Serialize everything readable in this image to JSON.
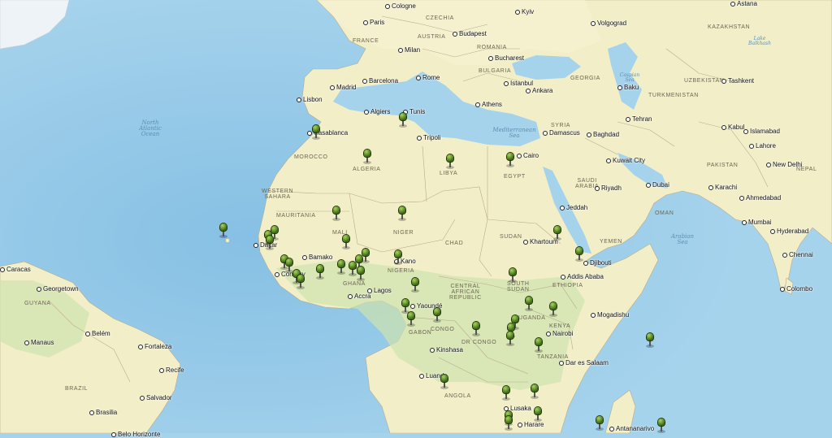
{
  "colors": {
    "ocean": "#a6d3ec",
    "ocean_deep": "#8dc4e6",
    "land": "#f2efc8",
    "land_green": "#c9e0a8",
    "border": "#b9aa8c",
    "pin": "#4f8a1b"
  },
  "oceans": [
    {
      "id": "north-atlantic",
      "text": "North\nAtlantic\nOcean"
    },
    {
      "id": "mediterranean",
      "text": "Mediterranean\nSea"
    },
    {
      "id": "arabian",
      "text": "Arabian\nSea"
    },
    {
      "id": "caspian",
      "text": "Caspian\nSea"
    },
    {
      "id": "lake-balkhash",
      "text": "Lake\nBalkhash"
    }
  ],
  "countries": [
    {
      "id": "france",
      "text": "FRANCE"
    },
    {
      "id": "czechia",
      "text": "CZECHIA"
    },
    {
      "id": "austria",
      "text": "AUSTRIA"
    },
    {
      "id": "romania",
      "text": "ROMANIA"
    },
    {
      "id": "bulgaria",
      "text": "BULGARIA"
    },
    {
      "id": "kazakhstan",
      "text": "KAZAKHSTAN"
    },
    {
      "id": "georgia",
      "text": "GEORGIA"
    },
    {
      "id": "uzbekistan",
      "text": "UZBEKISTAN"
    },
    {
      "id": "turkmenistan",
      "text": "TURKMENISTAN"
    },
    {
      "id": "syria",
      "text": "SYRIA"
    },
    {
      "id": "morocco",
      "text": "MOROCCO"
    },
    {
      "id": "algeria",
      "text": "ALGERIA"
    },
    {
      "id": "libya",
      "text": "LIBYA"
    },
    {
      "id": "egypt",
      "text": "EGYPT"
    },
    {
      "id": "saudi-arabia",
      "text": "SAUDI\nARABIA"
    },
    {
      "id": "oman",
      "text": "OMAN"
    },
    {
      "id": "pakistan",
      "text": "PAKISTAN"
    },
    {
      "id": "nepal",
      "text": "NEPAL"
    },
    {
      "id": "western-sahara",
      "text": "WESTERN\nSAHARA"
    },
    {
      "id": "mauritania",
      "text": "MAURITANIA"
    },
    {
      "id": "mali",
      "text": "MALI"
    },
    {
      "id": "niger",
      "text": "NIGER"
    },
    {
      "id": "chad",
      "text": "CHAD"
    },
    {
      "id": "sudan",
      "text": "SUDAN"
    },
    {
      "id": "yemen",
      "text": "YEMEN"
    },
    {
      "id": "south-sudan",
      "text": "SOUTH\nSUDAN"
    },
    {
      "id": "ethiopia",
      "text": "ETHIOPIA"
    },
    {
      "id": "central-african-republic",
      "text": "CENTRAL\nAFRICAN\nREPUBLIC"
    },
    {
      "id": "nigeria",
      "text": "NIGERIA"
    },
    {
      "id": "ghana",
      "text": "GHANA"
    },
    {
      "id": "gabon",
      "text": "GABON"
    },
    {
      "id": "congo",
      "text": "CONGO"
    },
    {
      "id": "dr-congo",
      "text": "DR CONGO"
    },
    {
      "id": "uganda",
      "text": "UGANDA"
    },
    {
      "id": "kenya",
      "text": "KENYA"
    },
    {
      "id": "tanzania",
      "text": "TANZANIA"
    },
    {
      "id": "angola",
      "text": "ANGOLA"
    },
    {
      "id": "guyana",
      "text": "GUYANA"
    },
    {
      "id": "brazil",
      "text": "BRAZIL"
    }
  ],
  "cities": [
    {
      "id": "cologne",
      "text": "Cologne"
    },
    {
      "id": "paris",
      "text": "Paris"
    },
    {
      "id": "kyiv",
      "text": "Kyiv"
    },
    {
      "id": "volgograd",
      "text": "Volgograd"
    },
    {
      "id": "astana",
      "text": "Astana"
    },
    {
      "id": "budapest",
      "text": "Budapest"
    },
    {
      "id": "milan",
      "text": "Milan"
    },
    {
      "id": "bucharest",
      "text": "Bucharest"
    },
    {
      "id": "madrid",
      "text": "Madrid"
    },
    {
      "id": "barcelona",
      "text": "Barcelona"
    },
    {
      "id": "rome",
      "text": "Rome"
    },
    {
      "id": "istanbul",
      "text": "Istanbul"
    },
    {
      "id": "ankara",
      "text": "Ankara"
    },
    {
      "id": "baku",
      "text": "Baku"
    },
    {
      "id": "tashkent",
      "text": "Tashkent"
    },
    {
      "id": "lisbon",
      "text": "Lisbon"
    },
    {
      "id": "athens",
      "text": "Athens"
    },
    {
      "id": "algiers",
      "text": "Algiers"
    },
    {
      "id": "tunis",
      "text": "Tunis"
    },
    {
      "id": "tehran",
      "text": "Tehran"
    },
    {
      "id": "kabul",
      "text": "Kabul"
    },
    {
      "id": "islamabad",
      "text": "Islamabad"
    },
    {
      "id": "lahore",
      "text": "Lahore"
    },
    {
      "id": "casablanca",
      "text": "Casablanca"
    },
    {
      "id": "tripoli",
      "text": "Tripoli"
    },
    {
      "id": "damascus",
      "text": "Damascus"
    },
    {
      "id": "baghdad",
      "text": "Baghdad"
    },
    {
      "id": "cairo",
      "text": "Cairo"
    },
    {
      "id": "kuwait-city",
      "text": "Kuwait City"
    },
    {
      "id": "new-delhi",
      "text": "New Delhi"
    },
    {
      "id": "riyadh",
      "text": "Riyadh"
    },
    {
      "id": "dubai",
      "text": "Dubai"
    },
    {
      "id": "karachi",
      "text": "Karachi"
    },
    {
      "id": "ahmedabad",
      "text": "Ahmedabad"
    },
    {
      "id": "jeddah",
      "text": "Jeddah"
    },
    {
      "id": "mumbai",
      "text": "Mumbai"
    },
    {
      "id": "hyderabad",
      "text": "Hyderabad"
    },
    {
      "id": "khartoum",
      "text": "Khartoum"
    },
    {
      "id": "dakar",
      "text": "Dakar"
    },
    {
      "id": "bamako",
      "text": "Bamako"
    },
    {
      "id": "kano",
      "text": "Kano"
    },
    {
      "id": "djibouti",
      "text": "Djibouti"
    },
    {
      "id": "chennai",
      "text": "Chennai"
    },
    {
      "id": "caracas",
      "text": "Caracas"
    },
    {
      "id": "conakry",
      "text": "Conakry"
    },
    {
      "id": "addis-ababa",
      "text": "Addis Ababa"
    },
    {
      "id": "colombo",
      "text": "Colombo"
    },
    {
      "id": "georgetown",
      "text": "Georgetown"
    },
    {
      "id": "lagos",
      "text": "Lagos"
    },
    {
      "id": "accra",
      "text": "Accra"
    },
    {
      "id": "yaounde",
      "text": "Yaoundé"
    },
    {
      "id": "mogadishu",
      "text": "Mogadishu"
    },
    {
      "id": "manaus",
      "text": "Manaus"
    },
    {
      "id": "belem",
      "text": "Belém"
    },
    {
      "id": "nairobi",
      "text": "Nairobi"
    },
    {
      "id": "fortaleza",
      "text": "Fortaleza"
    },
    {
      "id": "kinshasa",
      "text": "Kinshasa"
    },
    {
      "id": "dar-es-salaam",
      "text": "Dar es Salaam"
    },
    {
      "id": "recife",
      "text": "Recife"
    },
    {
      "id": "luanda",
      "text": "Luanda"
    },
    {
      "id": "salvador",
      "text": "Salvador"
    },
    {
      "id": "lusaka",
      "text": "Lusaka"
    },
    {
      "id": "brasilia",
      "text": "Brasilia"
    },
    {
      "id": "harare",
      "text": "Harare"
    },
    {
      "id": "antananarivo",
      "text": "Antananarivo"
    },
    {
      "id": "belo-horizonte",
      "text": "Belo Horizonte"
    }
  ],
  "pins": [
    "Casablanca",
    "Tunisia",
    "Algeria",
    "Libya",
    "Egypt",
    "Mali",
    "Niger",
    "Cape Verde",
    "Dakar",
    "Senegal",
    "The Gambia",
    "Guinea-Bissau",
    "Mali south",
    "Burkina Faso",
    "Nigeria north",
    "Guinea",
    "Sierra Leone",
    "Liberia",
    "Côte d'Ivoire",
    "Ghana",
    "Togo",
    "Benin",
    "Nigeria south",
    "Cameroon",
    "Gabon",
    "Congo",
    "Equatorial Guinea",
    "DR Congo",
    "Ethiopia north",
    "Djibouti",
    "Ethiopia",
    "South Sudan",
    "Uganda",
    "Kenya",
    "Rwanda",
    "Burundi",
    "Tanzania",
    "Seychelles",
    "Zambia north",
    "Angola",
    "Zambia",
    "Mozambique",
    "Zimbabwe",
    "Malawi",
    "Madagascar",
    "Mauritius"
  ]
}
